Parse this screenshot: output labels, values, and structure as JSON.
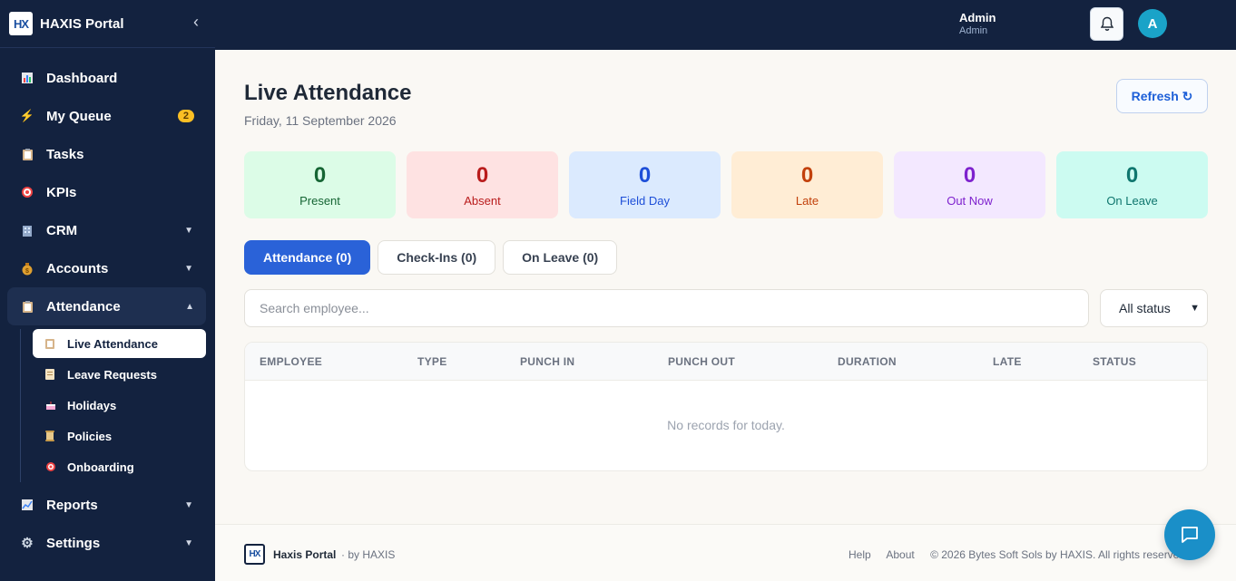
{
  "app": {
    "logo_text": "HX",
    "brand": "HAXIS Portal"
  },
  "sidebar": {
    "items": [
      {
        "label": "Dashboard",
        "icon": "bar-chart-icon"
      },
      {
        "label": "My Queue",
        "icon": "lightning-icon",
        "badge": "2"
      },
      {
        "label": "Tasks",
        "icon": "clipboard-icon"
      },
      {
        "label": "KPIs",
        "icon": "target-icon"
      },
      {
        "label": "CRM",
        "icon": "building-icon"
      },
      {
        "label": "Accounts",
        "icon": "money-bag-icon"
      },
      {
        "label": "Attendance",
        "icon": "clipboard-icon"
      }
    ],
    "attendance_sub": [
      {
        "label": "Live Attendance",
        "icon": "clipboard-icon"
      },
      {
        "label": "Leave Requests",
        "icon": "document-icon"
      },
      {
        "label": "Holidays",
        "icon": "cake-icon"
      },
      {
        "label": "Policies",
        "icon": "scroll-icon"
      },
      {
        "label": "Onboarding",
        "icon": "target-icon"
      }
    ],
    "bottom": [
      {
        "label": "Reports",
        "icon": "trend-chart-icon"
      },
      {
        "label": "Settings",
        "icon": "gear-icon"
      }
    ]
  },
  "topbar": {
    "user_initial": "A",
    "user_name": "Admin",
    "user_role": "Admin"
  },
  "page": {
    "title": "Live Attendance",
    "date": "Friday, 11 September 2026",
    "refresh_label": "Refresh ↻"
  },
  "stats": [
    {
      "value": "0",
      "label": "Present",
      "bg": "#dcfce7",
      "color": "#166534"
    },
    {
      "value": "0",
      "label": "Absent",
      "bg": "#fee2e2",
      "color": "#b91c1c"
    },
    {
      "value": "0",
      "label": "Field Day",
      "bg": "#dbeafe",
      "color": "#1d4ed8"
    },
    {
      "value": "0",
      "label": "Late",
      "bg": "#ffedd5",
      "color": "#c2410c"
    },
    {
      "value": "0",
      "label": "Out Now",
      "bg": "#f3e8ff",
      "color": "#7e22ce"
    },
    {
      "value": "0",
      "label": "On Leave",
      "bg": "#ccfbf1",
      "color": "#0f766e"
    }
  ],
  "tabs": [
    "Attendance (0)",
    "Check-Ins (0)",
    "On Leave (0)"
  ],
  "filters": {
    "search_placeholder": "Search employee...",
    "status_value": "All status"
  },
  "table": {
    "headers": [
      "EMPLOYEE",
      "TYPE",
      "PUNCH IN",
      "PUNCH OUT",
      "DURATION",
      "LATE",
      "STATUS"
    ],
    "empty_text": "No records for today."
  },
  "footer": {
    "logo_text": "HX",
    "brand": "Haxis Portal",
    "by": "· by HAXIS",
    "links": [
      "Help",
      "About"
    ],
    "copyright": "© 2026 Bytes Soft Sols by HAXIS. All rights reserved."
  }
}
